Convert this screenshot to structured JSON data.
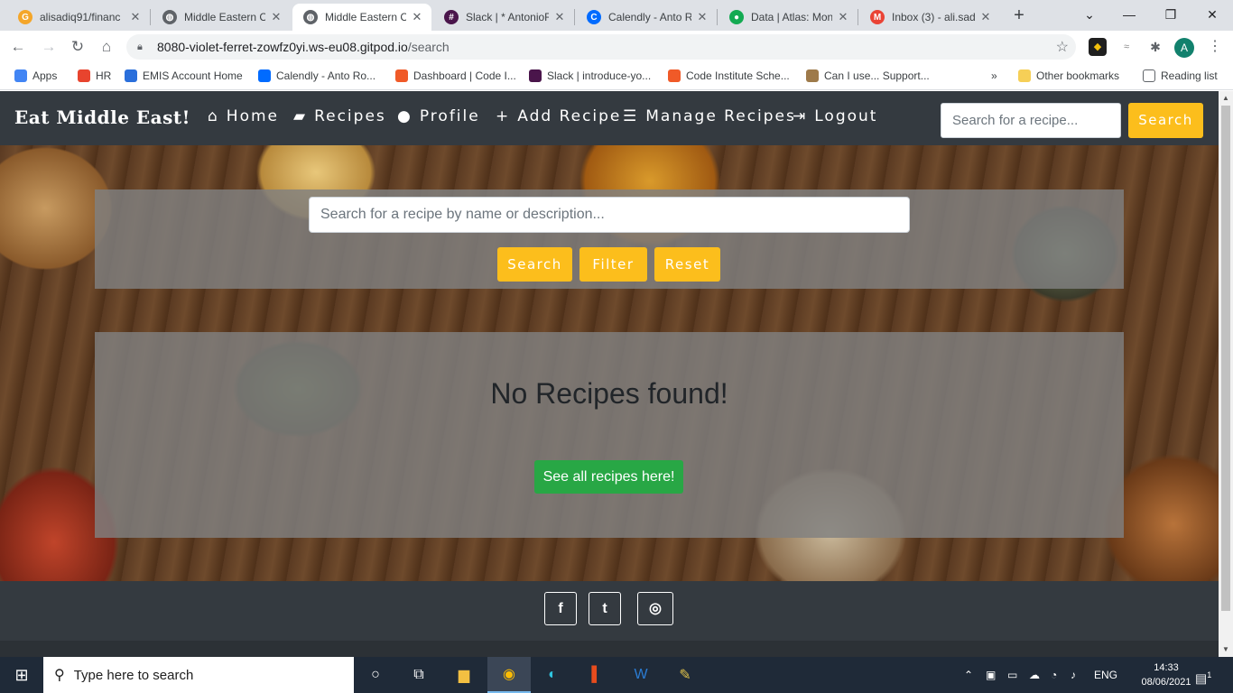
{
  "browser": {
    "tabs": [
      {
        "title": "alisadiq91/financ",
        "color": "#f4a62a",
        "glyph": "G"
      },
      {
        "title": "Middle Eastern C",
        "color": "#5f6368",
        "glyph": "◍"
      },
      {
        "title": "Middle Eastern C",
        "color": "#5f6368",
        "glyph": "◍"
      },
      {
        "title": "Slack | * AntonioR",
        "color": "#4a154b",
        "glyph": "#"
      },
      {
        "title": "Calendly - Anto R",
        "color": "#006bff",
        "glyph": "C"
      },
      {
        "title": "Data | Atlas: Mon",
        "color": "#13aa52",
        "glyph": "●"
      },
      {
        "title": "Inbox (3) - ali.sad",
        "color": "#ea4335",
        "glyph": "M"
      }
    ],
    "active_tab_index": 2,
    "url_host": "8080-violet-ferret-zowfz0yi.ws-eu08.gitpod.io",
    "url_path": "/search",
    "profile_initial": "A",
    "bookmarks": [
      {
        "label": "Apps",
        "color": "#4285f4"
      },
      {
        "label": "HR",
        "color": "#e8442e"
      },
      {
        "label": "EMIS Account Home",
        "color": "#2a6fdb"
      },
      {
        "label": "Calendly - Anto Ro...",
        "color": "#006bff"
      },
      {
        "label": "Dashboard | Code I...",
        "color": "#f05a28"
      },
      {
        "label": "Slack | introduce-yo...",
        "color": "#4a154b"
      },
      {
        "label": "Code Institute Sche...",
        "color": "#f05a28"
      },
      {
        "label": "Can I use... Support...",
        "color": "#9e7a4a"
      }
    ],
    "bookmarks_overflow": "»",
    "other_bookmarks": "Other bookmarks",
    "reading_list": "Reading list"
  },
  "site": {
    "brand": "Eat Middle East!",
    "nav": [
      {
        "label": "Home",
        "icon": "⌂"
      },
      {
        "label": "Recipes",
        "icon": "▰"
      },
      {
        "label": "Profile",
        "icon": "●"
      },
      {
        "label": "Add Recipe",
        "icon": "+"
      },
      {
        "label": "Manage Recipes",
        "icon": "☰"
      },
      {
        "label": "Logout",
        "icon": "⇥"
      }
    ],
    "nav_search_placeholder": "Search for a recipe...",
    "nav_search_button": "Search",
    "main_search_placeholder": "Search for a recipe by name or description...",
    "buttons": {
      "search": "Search",
      "filter": "Filter",
      "reset": "Reset"
    },
    "results_message": "No Recipes found!",
    "see_all_button": "See all recipes here!",
    "social": [
      {
        "name": "facebook",
        "glyph": "f"
      },
      {
        "name": "twitter",
        "glyph": "t"
      },
      {
        "name": "instagram",
        "glyph": "◎"
      }
    ],
    "colors": {
      "navbar": "#343a40",
      "accent": "#fcbe1c",
      "success": "#28a745"
    }
  },
  "taskbar": {
    "search_placeholder": "Type here to search",
    "language": "ENG",
    "time": "14:33",
    "date": "08/06/2021",
    "notification_count": "1"
  }
}
